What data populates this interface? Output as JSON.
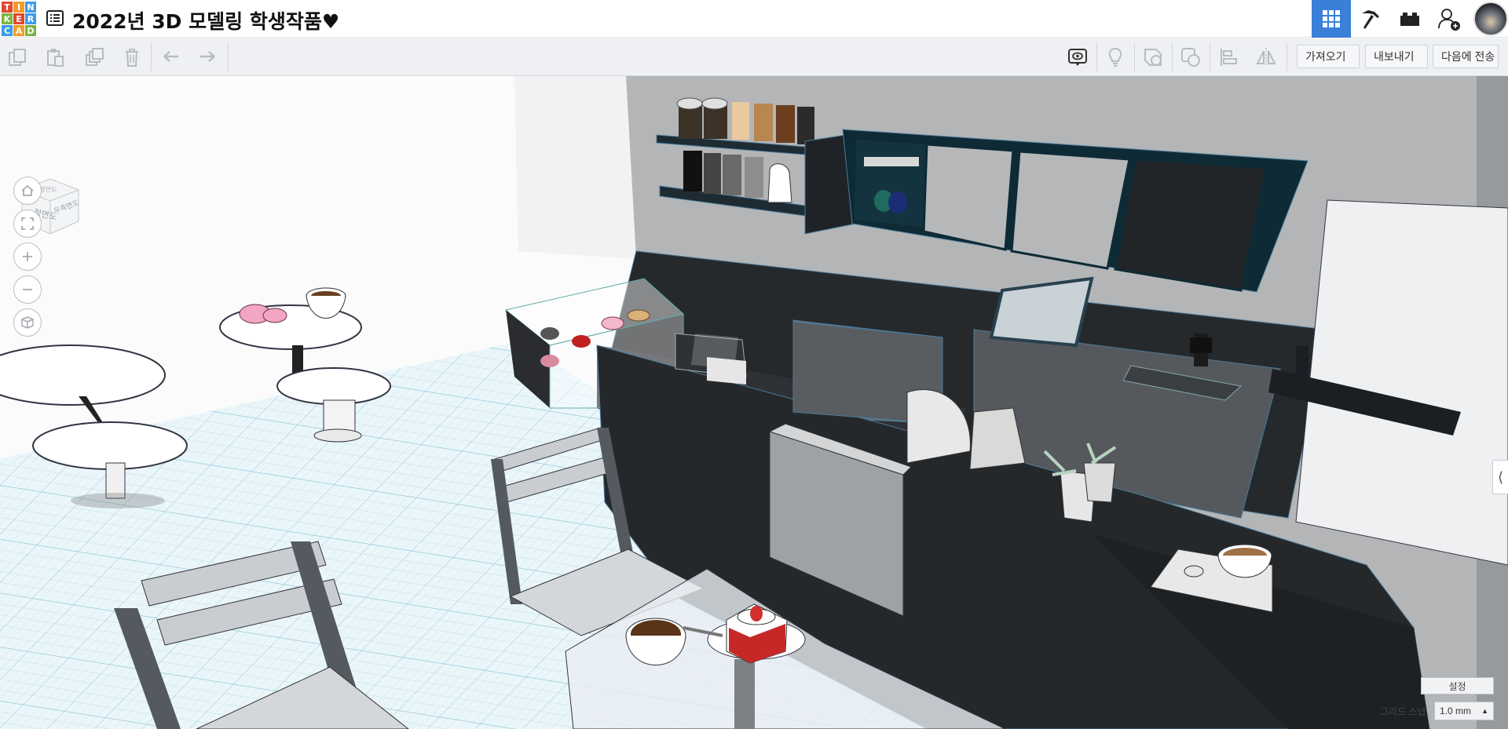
{
  "app": {
    "logo_letters": [
      "T",
      "I",
      "N",
      "K",
      "E",
      "R",
      "C",
      "A",
      "D"
    ],
    "logo_colors": [
      "#e2472d",
      "#f39c29",
      "#3d9be9",
      "#7cb342",
      "#e2472d",
      "#3d9be9",
      "#3d9be9",
      "#f39c29",
      "#7cb342"
    ],
    "title": "2022년 3D 모델링 학생작품♥",
    "accent_color": "#3a7fd8"
  },
  "header": {
    "buttons": [
      {
        "icon": "grid-view-icon",
        "active": true
      },
      {
        "icon": "pickaxe-icon",
        "active": false
      },
      {
        "icon": "bricks-icon",
        "active": false
      },
      {
        "icon": "add-user-icon",
        "active": false
      }
    ]
  },
  "toolbar": {
    "left_icons": [
      "copy-icon",
      "paste-icon",
      "duplicate-icon",
      "delete-icon",
      "undo-icon",
      "redo-icon"
    ],
    "right_icons": [
      "notes-icon",
      "light-bulb-icon",
      "shape-icon",
      "group-icon",
      "align-icon",
      "mirror-icon"
    ],
    "import_label": "가져오기",
    "export_label": "내보내기",
    "send_to_label": "다음에 전송"
  },
  "viewcube": {
    "front_label": "정면도",
    "right_label": "우측면도",
    "top_label": "평면도"
  },
  "nav": [
    "home-icon",
    "fit-view-icon",
    "zoom-in-icon",
    "zoom-out-icon",
    "perspective-icon"
  ],
  "footer": {
    "settings_label": "설정",
    "grid_snap_label": "그리드 스냅",
    "grid_snap_value": "1.0 mm"
  }
}
